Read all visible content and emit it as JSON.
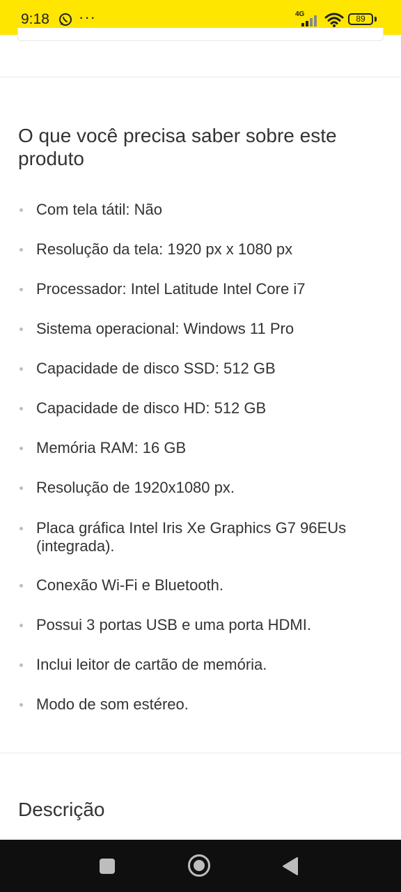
{
  "status_bar": {
    "time": "9:18",
    "more": "···",
    "network": "4G",
    "battery": "89"
  },
  "section": {
    "title": "O que você precisa saber sobre este produto",
    "items": [
      "Com tela tátil: Não",
      "Resolução da tela: 1920 px x 1080 px",
      "Processador: Intel Latitude Intel Core i7",
      "Sistema operacional: Windows 11 Pro",
      "Capacidade de disco SSD: 512 GB",
      "Capacidade de disco HD: 512 GB",
      "Memória RAM: 16 GB",
      "Resolução de 1920x1080 px.",
      "Placa gráfica Intel Iris Xe Graphics G7 96EUs (integrada).",
      "Conexão Wi-Fi e Bluetooth.",
      "Possui 3 portas USB e uma porta HDMI.",
      "Inclui leitor de cartão de memória.",
      "Modo de som estéreo."
    ]
  },
  "description": {
    "title": "Descrição"
  },
  "nav": {
    "recents": "recents-button",
    "home": "home-button",
    "back": "back-button"
  },
  "colors": {
    "status_bar_bg": "#fee600",
    "nav_bar_bg": "#0f0f0f"
  }
}
